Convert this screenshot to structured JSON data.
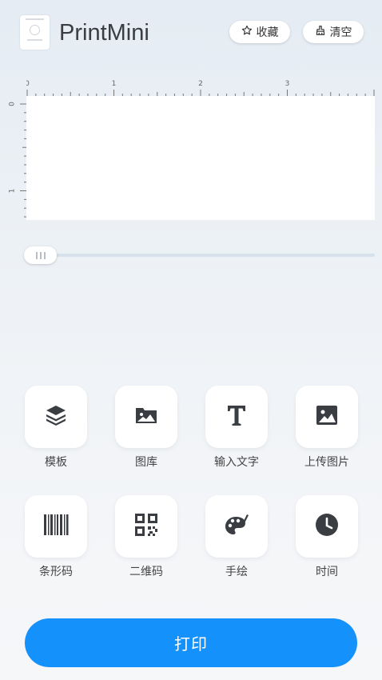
{
  "header": {
    "app_title": "PrintMini",
    "favorite_label": "收藏",
    "clear_label": "清空"
  },
  "ruler": {
    "top_labels": [
      "0",
      "1",
      "2",
      "3"
    ],
    "left_labels": [
      "0",
      "1"
    ]
  },
  "slider": {
    "value": 0
  },
  "tools": [
    {
      "label": "模板",
      "icon": "layers-icon"
    },
    {
      "label": "图库",
      "icon": "image-folder-icon"
    },
    {
      "label": "输入文字",
      "icon": "text-icon"
    },
    {
      "label": "上传图片",
      "icon": "image-icon"
    },
    {
      "label": "条形码",
      "icon": "barcode-icon"
    },
    {
      "label": "二维码",
      "icon": "qrcode-icon"
    },
    {
      "label": "手绘",
      "icon": "palette-icon"
    },
    {
      "label": "时间",
      "icon": "clock-icon"
    }
  ],
  "print_label": "打印",
  "colors": {
    "accent": "#1591fc",
    "icon": "#3a3d42"
  }
}
